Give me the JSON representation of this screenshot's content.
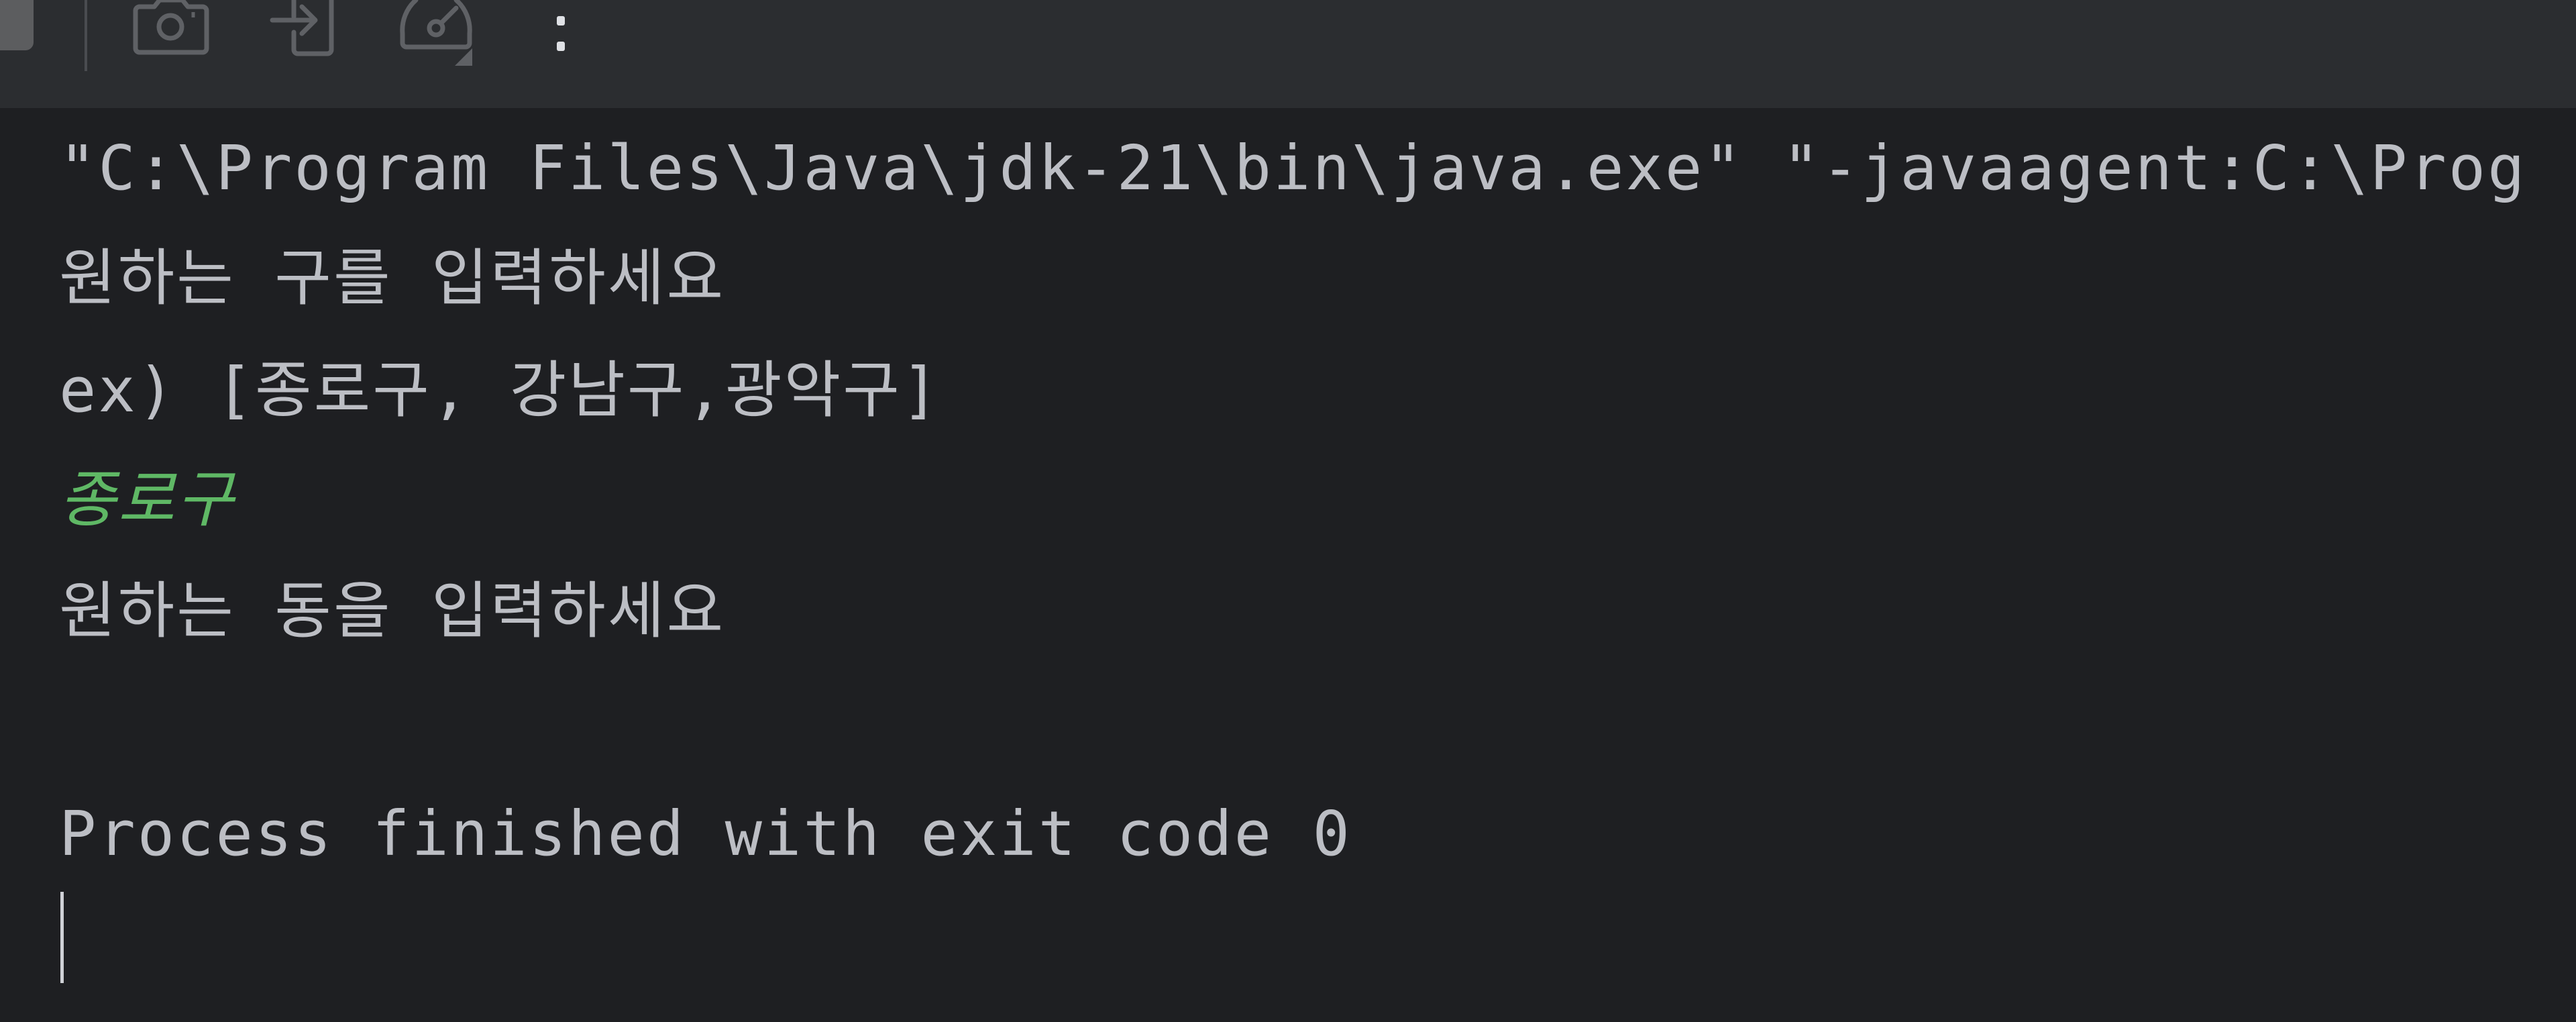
{
  "toolbar": {
    "buttons": [
      {
        "name": "stop",
        "icon": "stop-icon"
      },
      {
        "name": "screenshot",
        "icon": "camera-icon"
      },
      {
        "name": "import-input",
        "icon": "login-arrow-icon"
      },
      {
        "name": "profiler",
        "icon": "gauge-icon"
      },
      {
        "name": "more",
        "icon": "kebab-menu-icon"
      }
    ]
  },
  "console": {
    "lines": [
      {
        "text": "\"C:\\Program Files\\Java\\jdk-21\\bin\\java.exe\" \"-javaagent:C:\\Prog",
        "type": "system"
      },
      {
        "text": "원하는 구를 입력하세요",
        "type": "output"
      },
      {
        "text": "ex) [종로구, 강남구,광악구]",
        "type": "output"
      },
      {
        "text": "종로구",
        "type": "user-input"
      },
      {
        "text": "원하는 동을 입력하세요",
        "type": "output"
      },
      {
        "text": "",
        "type": "output"
      },
      {
        "text": "Process finished with exit code 0",
        "type": "system"
      }
    ]
  },
  "colors": {
    "background": "#1e1f22",
    "toolbar": "#2b2d30",
    "text": "#bcbec4",
    "user_input": "#5fb865"
  }
}
